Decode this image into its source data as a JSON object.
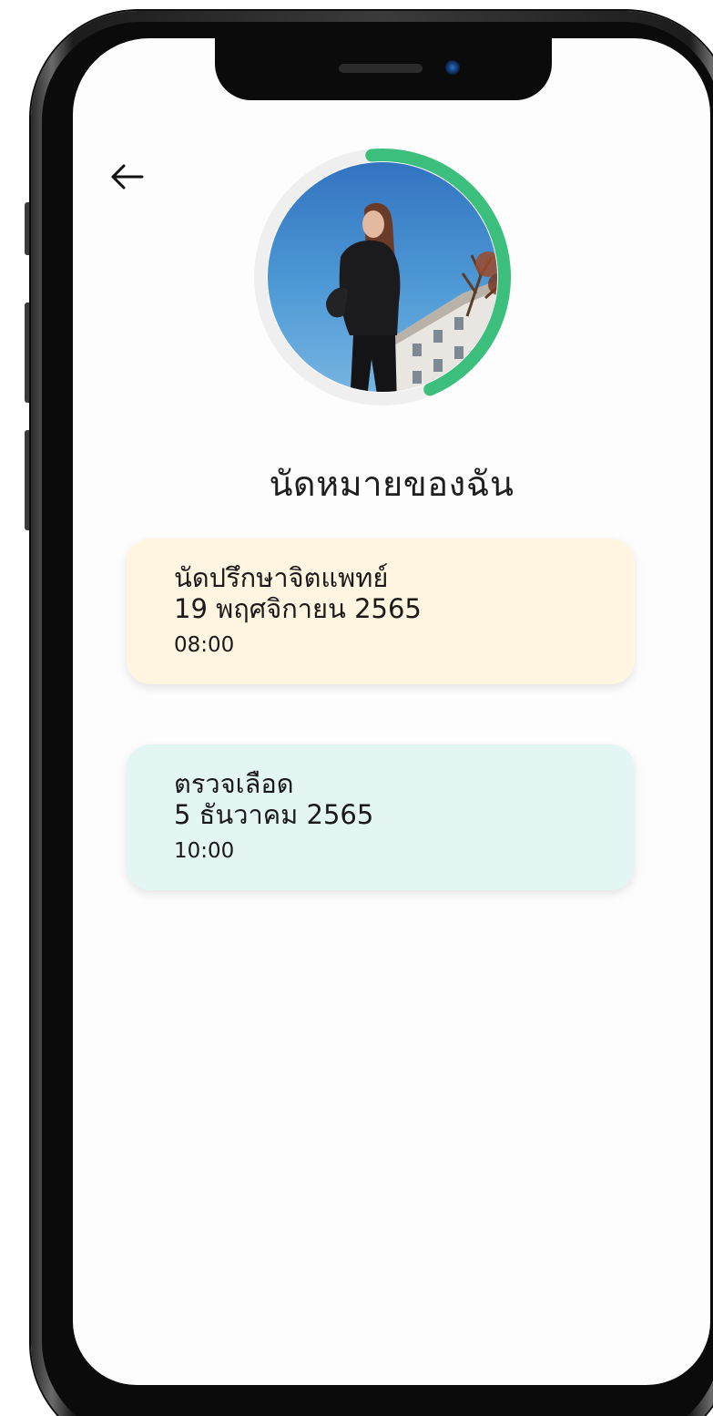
{
  "header": {
    "back_icon": "arrow-left-icon"
  },
  "profile": {
    "avatar_icon": "profile-photo",
    "progress_fraction": 0.45,
    "progress_color": "#3cbf7c",
    "track_color": "#efefef"
  },
  "page": {
    "title": "นัดหมายของฉัน"
  },
  "appointments": [
    {
      "title": "นัดปรึกษาจิตแพทย์",
      "date": "19 พฤศจิกายน 2565",
      "time": "08:00",
      "background": "#fff5e1"
    },
    {
      "title": "ตรวจเลือด",
      "date": "5 ธันวาคม 2565",
      "time": "10:00",
      "background": "#e3f6f4"
    }
  ]
}
